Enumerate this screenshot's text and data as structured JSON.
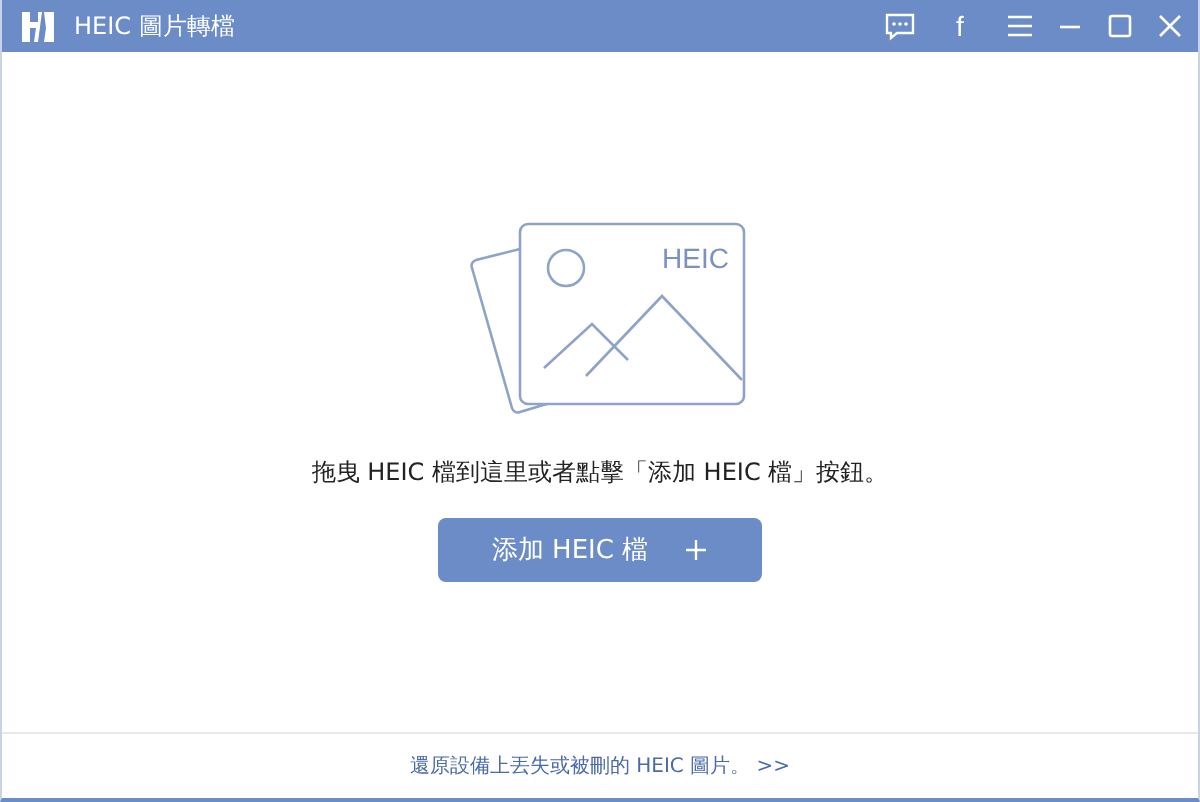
{
  "window": {
    "title": "HEIC 圖片轉檔",
    "buttons": [
      {
        "kind": "feedback"
      },
      {
        "kind": "facebook",
        "text": "f"
      },
      {
        "kind": "menu"
      },
      {
        "kind": "minimize"
      },
      {
        "kind": "maximize"
      },
      {
        "kind": "close"
      }
    ]
  },
  "drop_zone": {
    "image_label": "HEIC",
    "instruction": "拖曳 HEIC 檔到這里或者點擊「添加 HEIC 檔」按鈕。",
    "add_button": "添加 HEIC 檔"
  },
  "footer": {
    "link": "還原設備上丟失或被刪的 HEIC 圖片。 >>"
  }
}
